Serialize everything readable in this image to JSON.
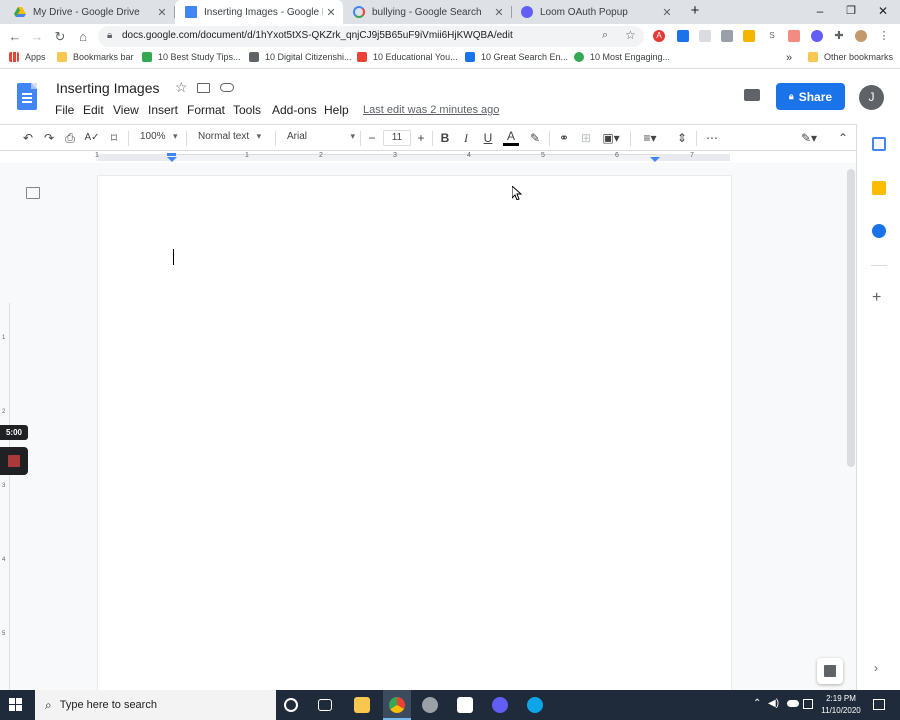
{
  "browser": {
    "tabs": [
      {
        "title": "My Drive - Google Drive",
        "active": false
      },
      {
        "title": "Inserting Images - Google Docs",
        "active": true
      },
      {
        "title": "bullying - Google Search",
        "active": false
      },
      {
        "title": "Loom OAuth Popup",
        "active": false
      }
    ],
    "url": "docs.google.com/document/d/1hYxot5tXS-QKZrk_qnjCJ9j5B65uF9iVmii6HjKWQBA/edit",
    "bookmarks": [
      "Apps",
      "Bookmarks bar",
      "10 Best Study Tips...",
      "10 Digital Citizenshi...",
      "10 Educational You...",
      "10 Great Search En...",
      "10 Most Engaging..."
    ],
    "other_bookmarks": "Other bookmarks",
    "overflow": "»",
    "icons": {
      "new_tab": "+",
      "minimize": "–",
      "maximize": "❐",
      "close": "✕"
    }
  },
  "docs": {
    "title": "Inserting Images",
    "menus": [
      "File",
      "Edit",
      "View",
      "Insert",
      "Format",
      "Tools",
      "Add-ons",
      "Help"
    ],
    "last_edit": "Last edit was 2 minutes ago",
    "share_label": "Share",
    "avatar_initial": "J",
    "toolbar": {
      "zoom": "100%",
      "style": "Normal text",
      "font": "Arial",
      "font_size": "11"
    },
    "ruler_numbers": [
      "1",
      "1",
      "2",
      "3",
      "4",
      "5",
      "6",
      "7"
    ],
    "vertical_ruler_numbers": [
      "1",
      "2",
      "3",
      "4",
      "5"
    ]
  },
  "loom": {
    "timer": "5:00"
  },
  "taskbar": {
    "search_placeholder": "Type here to search",
    "time": "2:19 PM",
    "date": "11/10/2020"
  },
  "colors": {
    "share": "#1a73e8",
    "docs_blue": "#4285f4",
    "taskbar": "#1f2b3b"
  }
}
